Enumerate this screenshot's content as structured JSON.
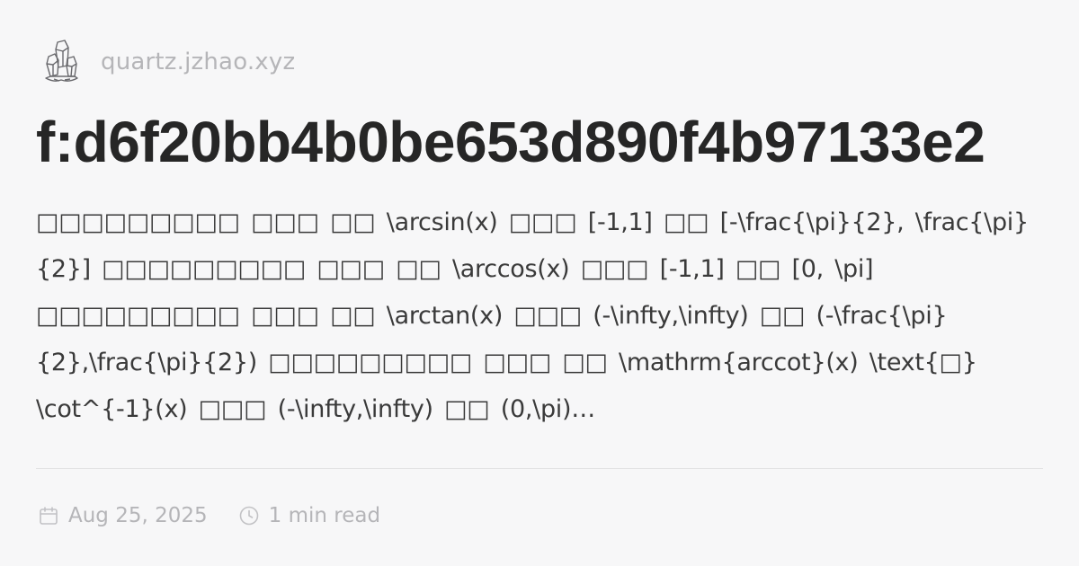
{
  "site": {
    "domain": "quartz.jzhao.xyz",
    "logo_icon": "crystal-icon"
  },
  "page": {
    "title": "f:d6f20bb4b0be653d890f4b97133e2",
    "description": "□□□□□□□□□  □□□  □□  \\arcsin(x) □□□  [-1,1] □□  [-\\frac{\\pi}{2}, \\frac{\\pi}{2}] □□□□□□□□□  □□□  □□  \\arccos(x) □□□  [-1,1] □□  [0, \\pi] □□□□□□□□□  □□□  □□  \\arctan(x) □□□  (-\\infty,\\infty) □□  (-\\frac{\\pi}{2},\\frac{\\pi}{2}) □□□□□□□□□  □□□  □□  \\mathrm{arccot}(x) \\text{□} \\cot^{-1}(x) □□□  (-\\infty,\\infty) □□  (0,\\pi)…"
  },
  "meta": {
    "date": "Aug 25, 2025",
    "date_icon": "calendar-icon",
    "read_time": "1 min read",
    "read_time_icon": "clock-icon"
  },
  "colors": {
    "background": "#f7f7f8",
    "title": "#262626",
    "body_text": "#3a3a3a",
    "muted": "#b5b5b8",
    "divider": "#e2e2e4"
  }
}
